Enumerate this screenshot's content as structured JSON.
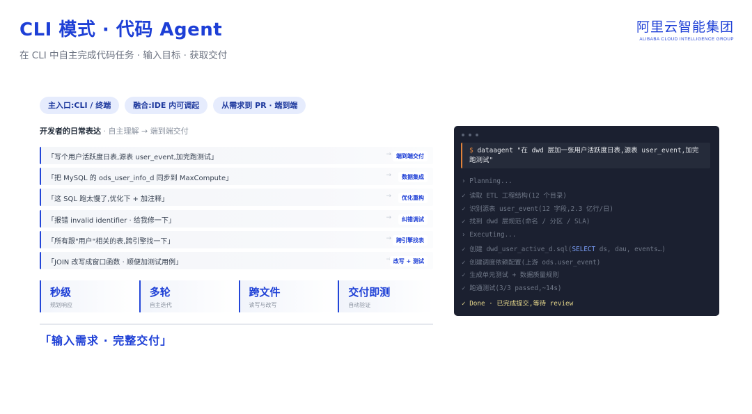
{
  "header": {
    "title": "CLI 模式 · 代码 Agent",
    "subtitle": "在 CLI 中自主完成代码任务 · 输入目标 · 获取交付"
  },
  "logo": {
    "cn": "阿里云智能集团",
    "en": "ALIBABA CLOUD INTELLIGENCE GROUP"
  },
  "tags": [
    "主入口:CLI / 终端",
    "融合:IDE 内可调起",
    "从需求到 PR · 端到端"
  ],
  "section": {
    "label": "开发者的日常表达",
    "note": " · 自主理解 → 端到端交付"
  },
  "requests": [
    {
      "text": "「写个用户活跃度日表,源表 user_event,加完跑测试」",
      "arrow": "→",
      "badge": "端到端交付"
    },
    {
      "text": "「把 MySQL 的 ods_user_info_d 同步到 MaxCompute」",
      "arrow": "→",
      "badge": "数据集成"
    },
    {
      "text": "「这 SQL 跑太慢了,优化下 + 加注释」",
      "arrow": "→",
      "badge": "优化重构"
    },
    {
      "text": "「报错 invalid identifier · 给我修一下」",
      "arrow": "→",
      "badge": "纠错调试"
    },
    {
      "text": "「所有跟\"用户\"相关的表,跨引擎找一下」",
      "arrow": "→",
      "badge": "跨引擎找表"
    },
    {
      "text": "「JOIN 改写成窗口函数 · 顺便加测试用例」",
      "arrow": "→",
      "badge": "改写 + 测试"
    }
  ],
  "stats": [
    {
      "title": "秒级",
      "sub": "规划响应"
    },
    {
      "title": "多轮",
      "sub": "自主迭代"
    },
    {
      "title": "跨文件",
      "sub": "读写与改写"
    },
    {
      "title": "交付即测",
      "sub": "自动验证"
    }
  ],
  "tagline": "「输入需求 · 完整交付」",
  "terminal": {
    "prompt": "$",
    "command": " dataagent \"在 dwd 层加一张用户活跃度日表,源表 user_event,加完跑测试\"",
    "planning": "› Planning...",
    "plan_lines": [
      "✓ 读取 ETL 工程结构(12 个目录)",
      "✓ 识别源表 user_event(12 字段,2.3 亿行/日)",
      "✓ 找到 dwd 层规范(命名 / 分区 / SLA)"
    ],
    "executing": "› Executing...",
    "exec_line_pre": "✓ 创建 dwd_user_active_d.sql(",
    "exec_line_kw": "SELECT",
    "exec_line_post": " ds, dau, events…)",
    "exec_lines": [
      "✓ 创建调度依赖配置(上游 ods.user_event)",
      "✓ 生成单元测试 + 数据质量规则",
      "✓ 跑通测试(3/3 passed,~14s)"
    ],
    "done": "✓ Done · 已完成提交,等待 review"
  },
  "colors": {
    "accent": "#1d3fd6",
    "terminal_bg": "#1b2030",
    "prompt_orange": "#e0823a",
    "done_yellow": "#e7d98c"
  }
}
